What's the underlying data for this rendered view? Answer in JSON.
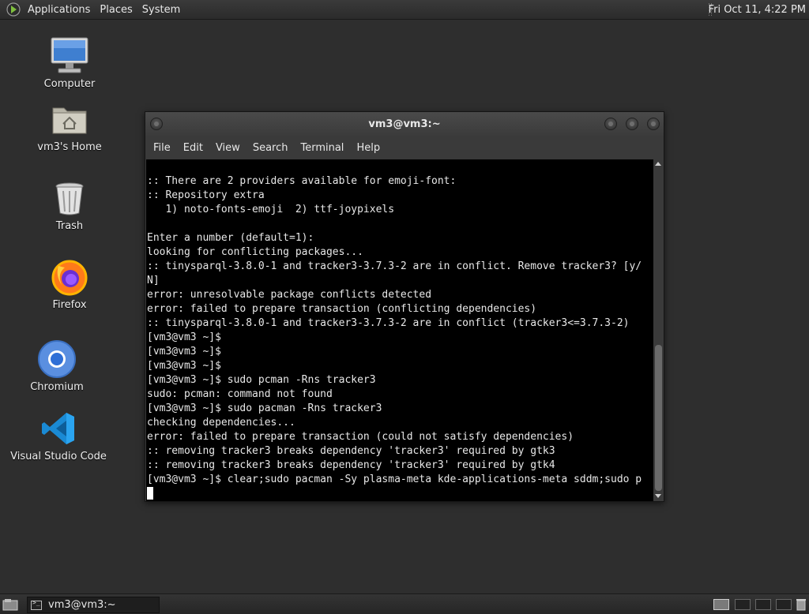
{
  "top_panel": {
    "menus": [
      "Applications",
      "Places",
      "System"
    ],
    "clock": "Fri Oct 11,  4:22 PM"
  },
  "desktop_icons": [
    {
      "label": "Computer",
      "icon": "computer-icon"
    },
    {
      "label": "vm3's Home",
      "icon": "home-folder-icon"
    },
    {
      "label": "Trash",
      "icon": "trash-icon"
    },
    {
      "label": "Firefox",
      "icon": "firefox-icon"
    },
    {
      "label": "Chromium",
      "icon": "chromium-icon"
    },
    {
      "label": "Visual Studio Code",
      "icon": "vscode-icon"
    }
  ],
  "terminal": {
    "title": "vm3@vm3:~",
    "menus": [
      "File",
      "Edit",
      "View",
      "Search",
      "Terminal",
      "Help"
    ],
    "lines": [
      ":: There are 2 providers available for emoji-font:",
      ":: Repository extra",
      "   1) noto-fonts-emoji  2) ttf-joypixels",
      "",
      "Enter a number (default=1):",
      "looking for conflicting packages...",
      ":: tinysparql-3.8.0-1 and tracker3-3.7.3-2 are in conflict. Remove tracker3? [y/",
      "N]",
      "error: unresolvable package conflicts detected",
      "error: failed to prepare transaction (conflicting dependencies)",
      ":: tinysparql-3.8.0-1 and tracker3-3.7.3-2 are in conflict (tracker3<=3.7.3-2)",
      "[vm3@vm3 ~]$",
      "[vm3@vm3 ~]$",
      "[vm3@vm3 ~]$",
      "[vm3@vm3 ~]$ sudo pcman -Rns tracker3",
      "sudo: pcman: command not found",
      "[vm3@vm3 ~]$ sudo pacman -Rns tracker3",
      "checking dependencies...",
      "error: failed to prepare transaction (could not satisfy dependencies)",
      ":: removing tracker3 breaks dependency 'tracker3' required by gtk3",
      ":: removing tracker3 breaks dependency 'tracker3' required by gtk4",
      "[vm3@vm3 ~]$ clear;sudo pacman -Sy plasma-meta kde-applications-meta sddm;sudo p"
    ]
  },
  "taskbar": {
    "task_label": "vm3@vm3:~"
  }
}
